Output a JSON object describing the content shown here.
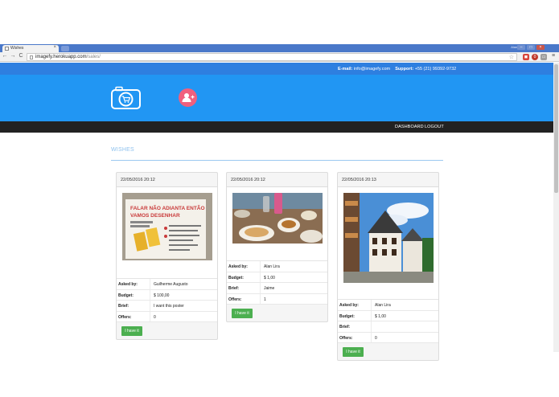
{
  "browser": {
    "tab_title": "Wishes",
    "tab_close": "×",
    "user_name": "Alan Lira",
    "url_host": "imagefy.herokuapp.com",
    "url_path": "/sales/",
    "back": "←",
    "forward": "→",
    "reload": "C",
    "bookmark_star": "☆",
    "ext_badge": "0",
    "menu": "≡"
  },
  "site": {
    "email_label": "E-mail:",
    "email_value": "info@imagefy.com",
    "support_label": "Support:",
    "support_value": "+55 (21) 99392-9732",
    "nav": {
      "dashboard": "DASHBOARD",
      "logout": "LOGOUT"
    },
    "section_title": "WISHES",
    "colors": {
      "topbar": "#2e7fe0",
      "hero": "#2196f3",
      "navbar": "#222222",
      "accent_pink": "#f0607e",
      "button_green": "#4caf50"
    }
  },
  "cards": [
    {
      "date": "22/05/2016 20:12",
      "asked_by_label": "Asked by:",
      "asked_by": "Guilherme Augusto",
      "budget_label": "Budget:",
      "budget": "$ 100,00",
      "brief_label": "Brief:",
      "brief": "I want this poster",
      "offers_label": "Offers:",
      "offers": "0",
      "button": "I have it",
      "photo_text_1": "FALAR NÃO ADIANTA ENTÃO",
      "photo_text_2": "VAMOS DESENHAR"
    },
    {
      "date": "22/05/2016 20:12",
      "asked_by_label": "Asked by:",
      "asked_by": "Alan Lira",
      "budget_label": "Budget:",
      "budget": "$ 1,00",
      "brief_label": "Brief:",
      "brief": "Jaime",
      "offers_label": "Offers:",
      "offers": "1",
      "button": "I have it"
    },
    {
      "date": "22/05/2016 20:13",
      "asked_by_label": "Asked by:",
      "asked_by": "Alan Lira",
      "budget_label": "Budget:",
      "budget": "$ 1,00",
      "brief_label": "Brief:",
      "brief": "",
      "offers_label": "Offers:",
      "offers": "0",
      "button": "I have it"
    }
  ]
}
